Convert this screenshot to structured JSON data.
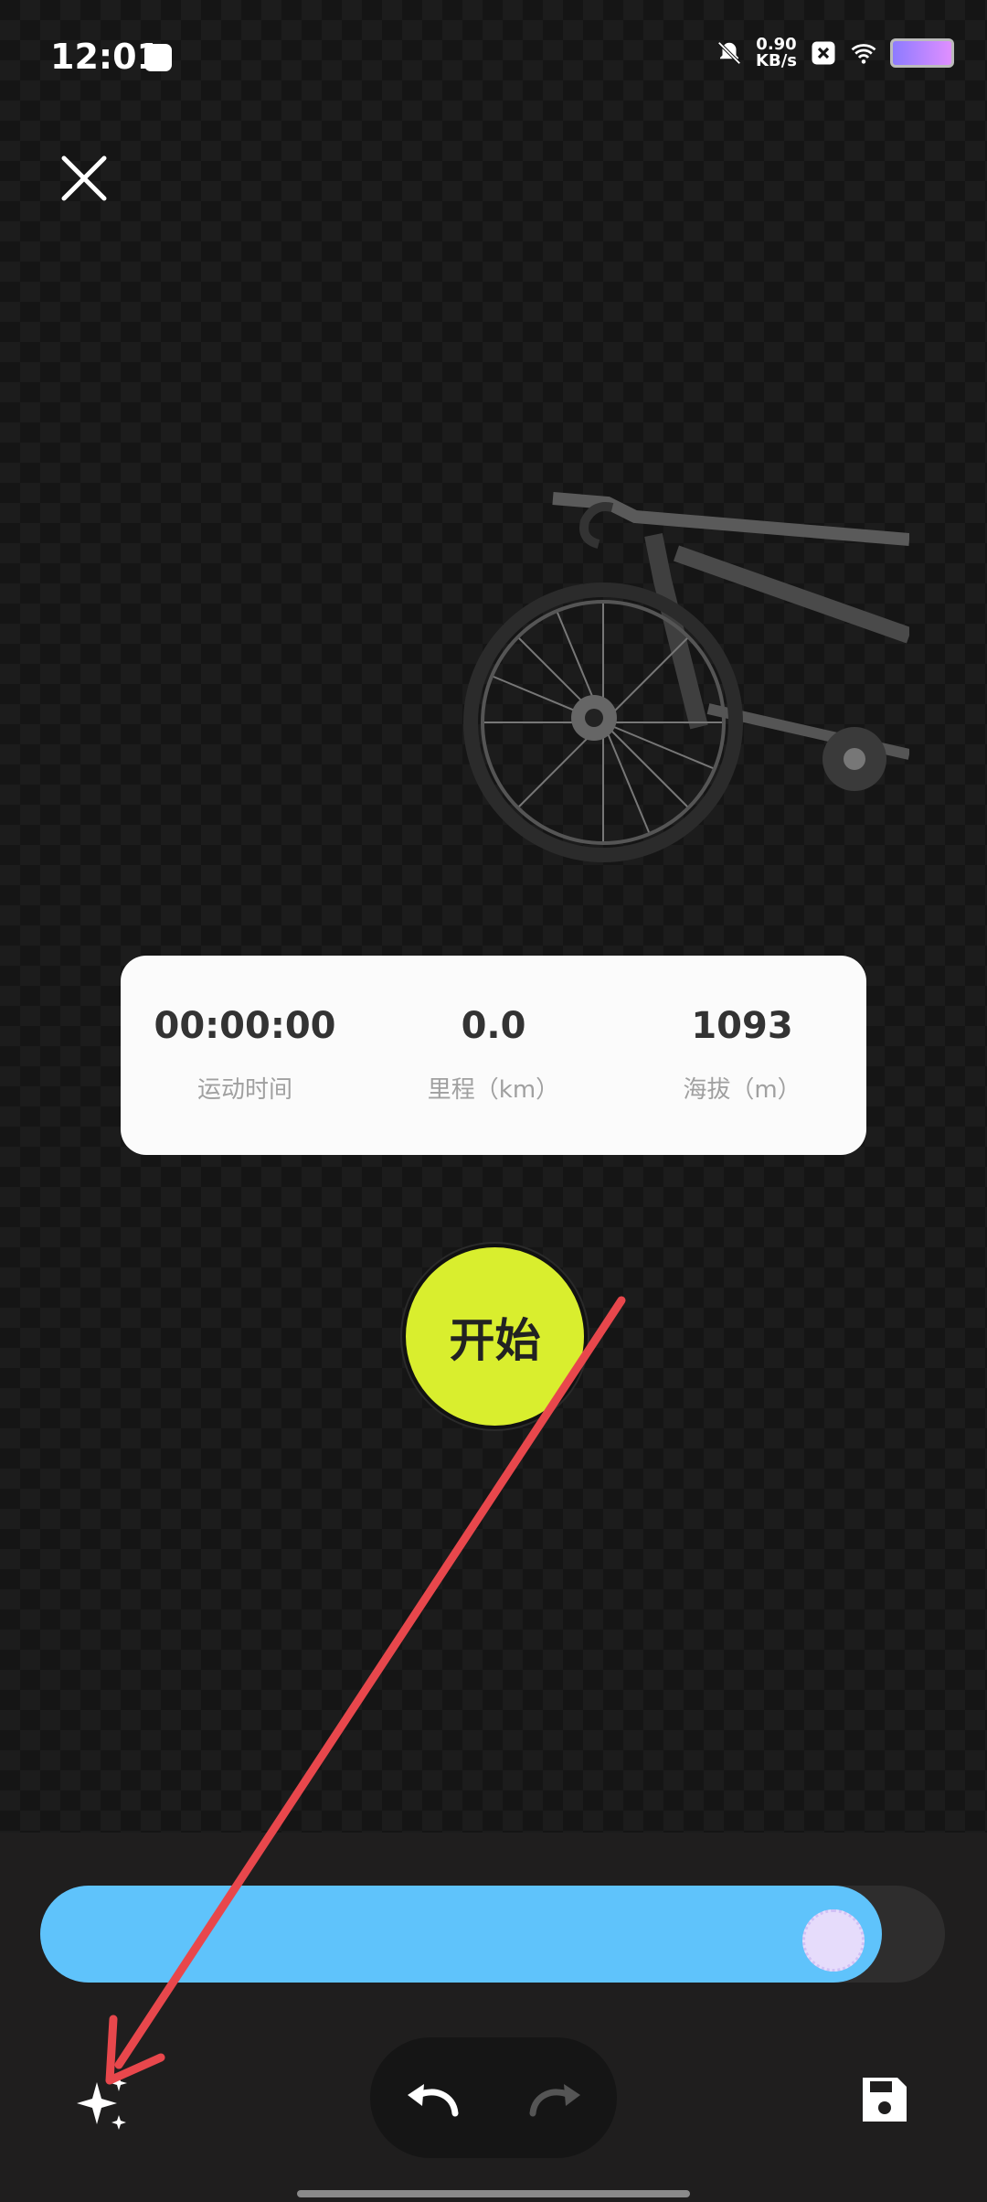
{
  "status_bar": {
    "time": "12:01",
    "net_speed_value": "0.90",
    "net_speed_unit": "KB/s",
    "icons": [
      "mute-bell-icon",
      "close-square-icon",
      "wifi-icon",
      "battery-icon"
    ]
  },
  "stats": {
    "time_value": "00:00:00",
    "time_label": "运动时间",
    "distance_value": "0.0",
    "distance_label": "里程（km）",
    "altitude_value": "1093",
    "altitude_label": "海拔（m）"
  },
  "start_button": {
    "label": "开始"
  },
  "slider": {
    "value_percent": 93
  },
  "toolbar": {
    "icons": [
      "sparkle-icon",
      "undo-icon",
      "redo-icon",
      "save-icon"
    ]
  },
  "colors": {
    "start_button": "#d9ee2e",
    "slider_fill": "#5fc3fb",
    "annotation_arrow": "#e8474c"
  }
}
